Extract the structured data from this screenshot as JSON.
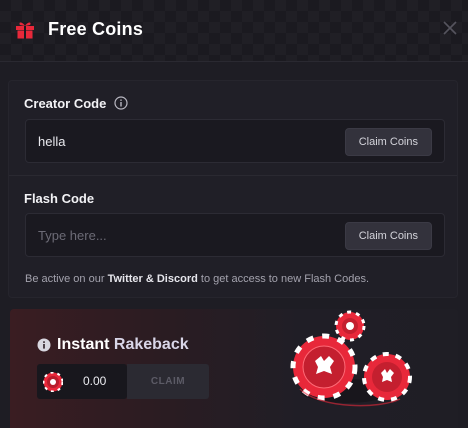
{
  "modal": {
    "title": "Free Coins",
    "icons": {
      "title": "gift-icon",
      "close": "close-icon"
    }
  },
  "creator_code": {
    "label": "Creator Code",
    "value": "hella",
    "button_label": "Claim Coins",
    "icon": "info-icon"
  },
  "flash_code": {
    "label": "Flash Code",
    "placeholder": "Type here...",
    "button_label": "Claim Coins",
    "note_prefix": "Be active on our ",
    "note_highlight": "Twitter & Discord",
    "note_suffix": " to get access to new Flash Codes."
  },
  "rakeback": {
    "title_part1": "Instant",
    "title_part2": "Rakeback",
    "amount": "0.00",
    "claim_label": "CLAIM",
    "icons": {
      "info": "info-icon",
      "chip": "casino-chip-icon"
    }
  },
  "colors": {
    "background": "#1e1d24",
    "accent_red": "#e8283a",
    "button": "#33323c"
  }
}
